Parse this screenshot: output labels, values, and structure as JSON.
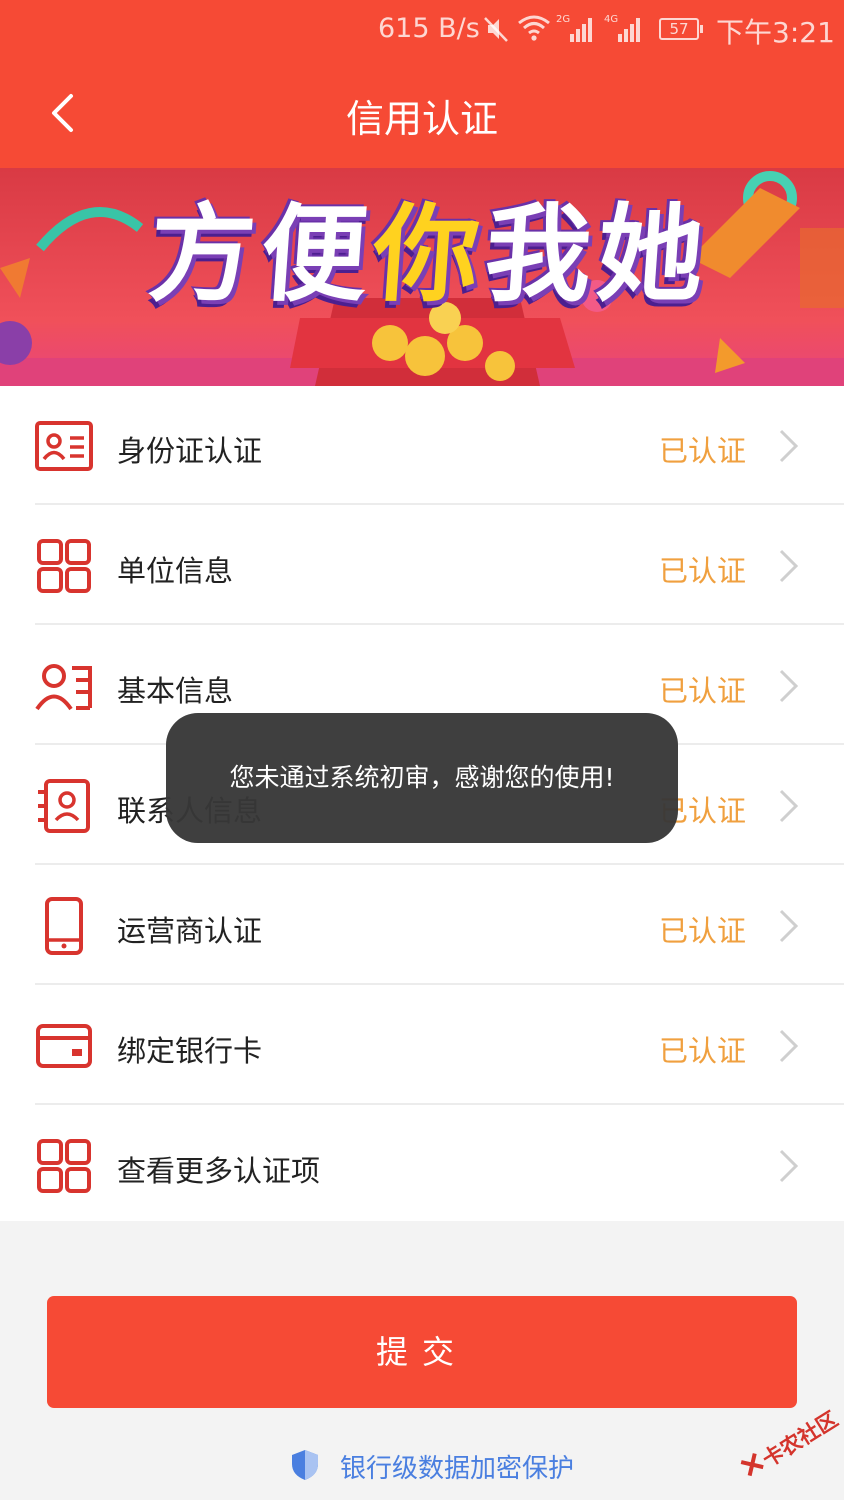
{
  "status_bar": {
    "net_speed": "615 B/s",
    "signal_2g": "2G",
    "signal_4g": "4G",
    "battery": "57",
    "time": "下午3:21"
  },
  "nav": {
    "title": "信用认证",
    "back_icon": "chevron-left-icon"
  },
  "banner": {
    "text_1": "方便",
    "text_highlight": "你",
    "text_2": "我她",
    "colors": {
      "text": "#ffffff",
      "highlight": "#ffd21f",
      "bg": "#e8404a"
    }
  },
  "items": [
    {
      "icon": "id-card-icon",
      "label": "身份证认证",
      "status": "已认证"
    },
    {
      "icon": "grid-icon",
      "label": "单位信息",
      "status": "已认证"
    },
    {
      "icon": "user-list-icon",
      "label": "基本信息",
      "status": "已认证"
    },
    {
      "icon": "contact-book-icon",
      "label": "联系人信息",
      "status": "已认证"
    },
    {
      "icon": "phone-icon",
      "label": "运营商认证",
      "status": "已认证"
    },
    {
      "icon": "bank-card-icon",
      "label": "绑定银行卡",
      "status": "已认证"
    },
    {
      "icon": "grid-icon",
      "label": "查看更多认证项",
      "status": ""
    }
  ],
  "submit_label": "提交",
  "security_text": "银行级数据加密保护",
  "watermark": "卡农社区",
  "toast": "您未通过系统初审，感谢您的使用!",
  "colors": {
    "brand": "#f64a35",
    "status": "#f0a03f",
    "link": "#4a7fe0"
  }
}
